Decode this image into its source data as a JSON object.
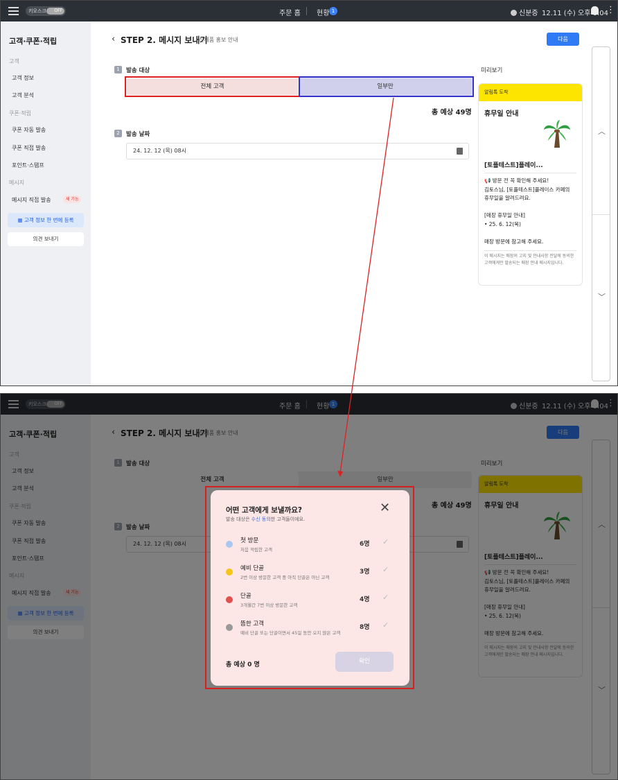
{
  "topbar": {
    "kiosk": "키오스크",
    "kiosk_state": "OFF",
    "order_home": "주문 홈",
    "status": "현황",
    "status_count": "1",
    "user": "신분증",
    "datetime": "12.11 (수) 오후 8:04"
  },
  "sidebar": {
    "title": "고객·쿠폰·적립",
    "section_customer": "고객",
    "customer_info": "고객 정보",
    "customer_analysis": "고객 분석",
    "section_coupon": "쿠폰·적립",
    "coupon_auto": "쿠폰 자동 발송",
    "coupon_direct": "쿠폰 직접 발송",
    "point_stamp": "포인트·스탬프",
    "section_message": "메시지",
    "message_direct": "메시지 직접 발송",
    "new_feature": "새 기능",
    "register_customer": "고객 정보 한 번에 등록",
    "feedback": "의견 보내기"
  },
  "main": {
    "step_title": "STEP 2. 메시지 보내기",
    "step_subtitle": "신제품 홍보 안내",
    "next_button": "다음",
    "target_number": "1",
    "target_label": "발송 대상",
    "option_all": "전체 고객",
    "option_some": "일부만",
    "total_expected": "총 예상 49명",
    "date_number": "2",
    "date_label": "발송 날짜",
    "date_value": "24. 12. 12 (목) 08시"
  },
  "preview": {
    "label": "미리보기",
    "header": "알림톡 도착",
    "title": "휴무일 안내",
    "store_name": "[토플테스트]플레이...",
    "body_lines": [
      "📢 방문 전 꼭 확인해 주세요!",
      "김토스님, [토플테스트]플레이스 카페의",
      "휴무일을 알려드려요.",
      "",
      "[매장 휴무일 안내]",
      "• 25. 6. 12(목)",
      "",
      "매장 방문에 참고해 주세요."
    ],
    "note": "이 메시지는 매장의 고지 및 안내사항 전달에 동의한 고객에게만 발송되는 매장 안내 메시지입니다."
  },
  "modal": {
    "title": "어떤 고객에게 보낼까요?",
    "subtitle_pre": "발송 대상은 ",
    "subtitle_link": "수신 동의",
    "subtitle_post": "한 고객들이에요.",
    "rows": [
      {
        "name": "첫 방문",
        "desc": "처음 적립한 고객",
        "count": "6명"
      },
      {
        "name": "예비 단골",
        "desc": "2번 이상 방문한 고객 중 아직 단골은 아닌 고객",
        "count": "3명"
      },
      {
        "name": "단골",
        "desc": "3개월간 7번 이상 방문한 고객",
        "count": "4명"
      },
      {
        "name": "뜸한 고객",
        "desc": "예비 단골 또는 단골이면서 45일 동안 오지 않은 고객",
        "count": "8명"
      }
    ],
    "total": "총 예상 0 명",
    "confirm": "확인"
  },
  "colors": {
    "accent": "#2f7bf5",
    "topbar": "#2b2f36",
    "kakao_yellow": "#fee500",
    "highlight_red": "#e02020",
    "highlight_blue": "#3333cc"
  }
}
